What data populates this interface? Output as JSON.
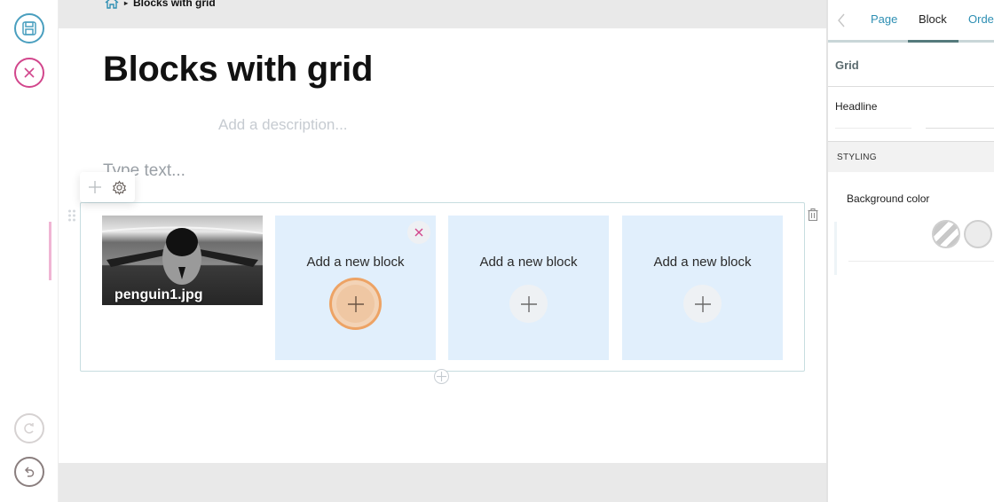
{
  "toolbar": {
    "save_icon": "floppy-disk-icon",
    "cancel_icon": "close-circle-icon",
    "redo_icon": "redo-icon",
    "undo_icon": "undo-icon"
  },
  "breadcrumb": {
    "home_icon": "home-icon",
    "separator": "▸",
    "current": "Blocks with grid"
  },
  "page": {
    "title": "Blocks with grid",
    "description_placeholder": "Add a description...",
    "text_placeholder": "Type text..."
  },
  "grid": {
    "image": {
      "caption": "penguin1.jpg"
    },
    "cells": [
      {
        "label": "Add a new block",
        "active": true,
        "removable": true
      },
      {
        "label": "Add a new block",
        "active": false,
        "removable": false
      },
      {
        "label": "Add a new block",
        "active": false,
        "removable": false
      }
    ]
  },
  "sidebar": {
    "tabs": [
      {
        "label": "Page",
        "active": false
      },
      {
        "label": "Block",
        "active": true
      },
      {
        "label": "Order",
        "active": false
      }
    ],
    "section_title": "Grid",
    "headline_label": "Headline",
    "styling_label": "STYLING",
    "background_color_label": "Background color",
    "swatches": [
      "transparent",
      "#ececec"
    ]
  },
  "colors": {
    "accent_blue": "#2e8fb3",
    "accent_pink": "#d2468c",
    "cell_bg": "#e1effc",
    "active_orange": "#eda365"
  }
}
